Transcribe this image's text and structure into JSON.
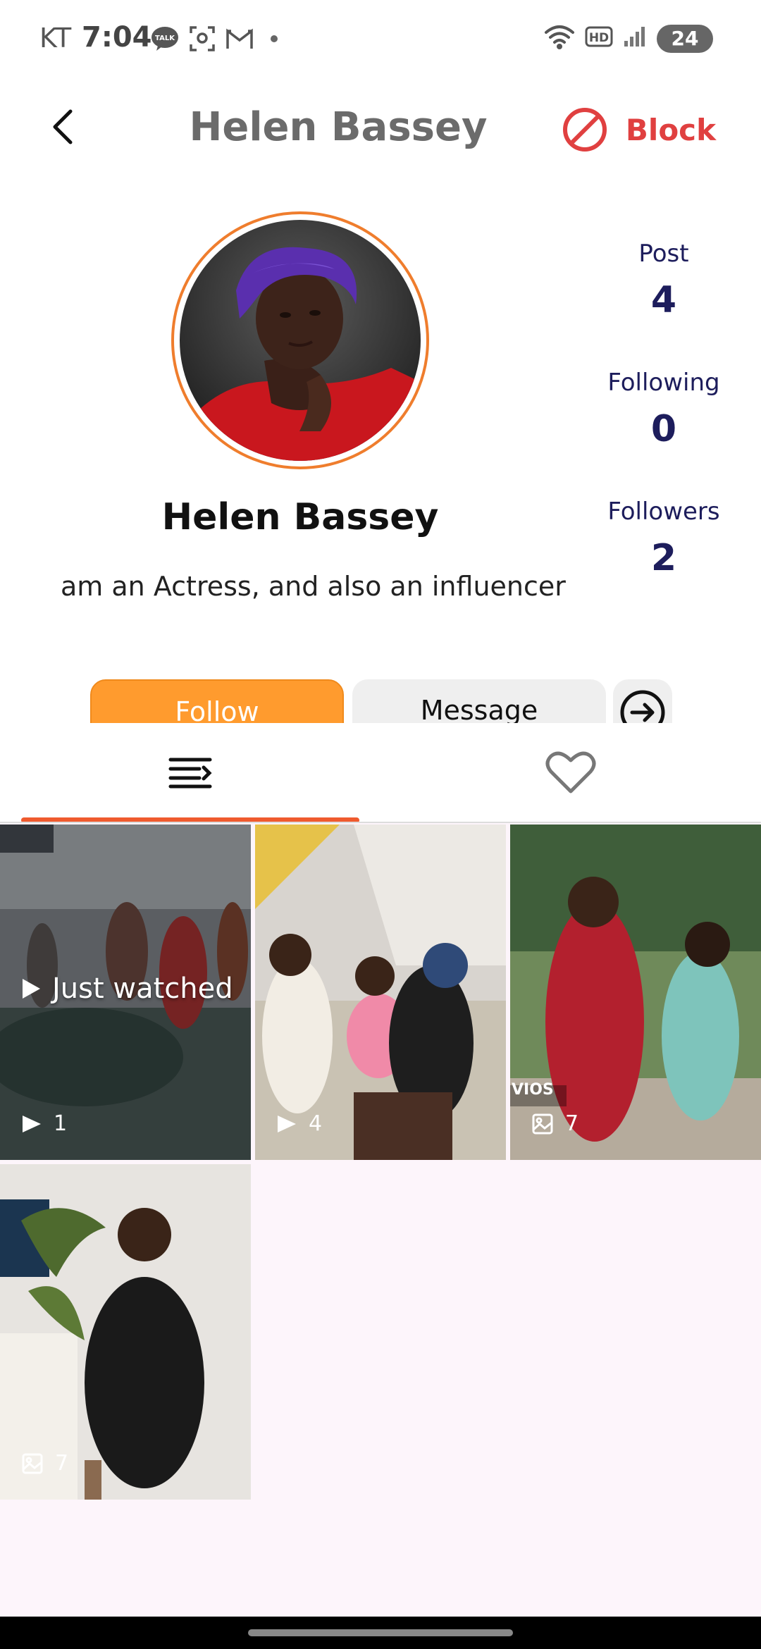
{
  "status_bar": {
    "carrier": "KT",
    "time": "7:04",
    "battery": "24",
    "talk_icon_text": "TALK",
    "network_badge": "HD"
  },
  "header": {
    "title": "Helen Bassey",
    "block_label": "Block"
  },
  "profile": {
    "name": "Helen Bassey",
    "bio": "am an Actress, and also an influencer"
  },
  "stats": {
    "post_label": "Post",
    "post_value": "4",
    "following_label": "Following",
    "following_value": "0",
    "followers_label": "Followers",
    "followers_value": "2"
  },
  "actions": {
    "follow_label": "Follow",
    "message_label": "Message"
  },
  "tabs": [
    "posts-tab",
    "likes-tab"
  ],
  "grid": [
    {
      "type": "video",
      "count": "1",
      "label": "Just watched",
      "watermark": ""
    },
    {
      "type": "video",
      "count": "4",
      "label": "",
      "watermark": ""
    },
    {
      "type": "image",
      "count": "7",
      "label": "",
      "watermark": "VIOS"
    },
    {
      "type": "image",
      "count": "7",
      "label": "",
      "watermark": ""
    }
  ],
  "colors": {
    "accent_orange": "#ff9b2e",
    "tab_indicator": "#ef5a2e",
    "block_red": "#e04040",
    "stat_navy": "#1d1d5c",
    "grid_background": "#fdf5fb"
  }
}
